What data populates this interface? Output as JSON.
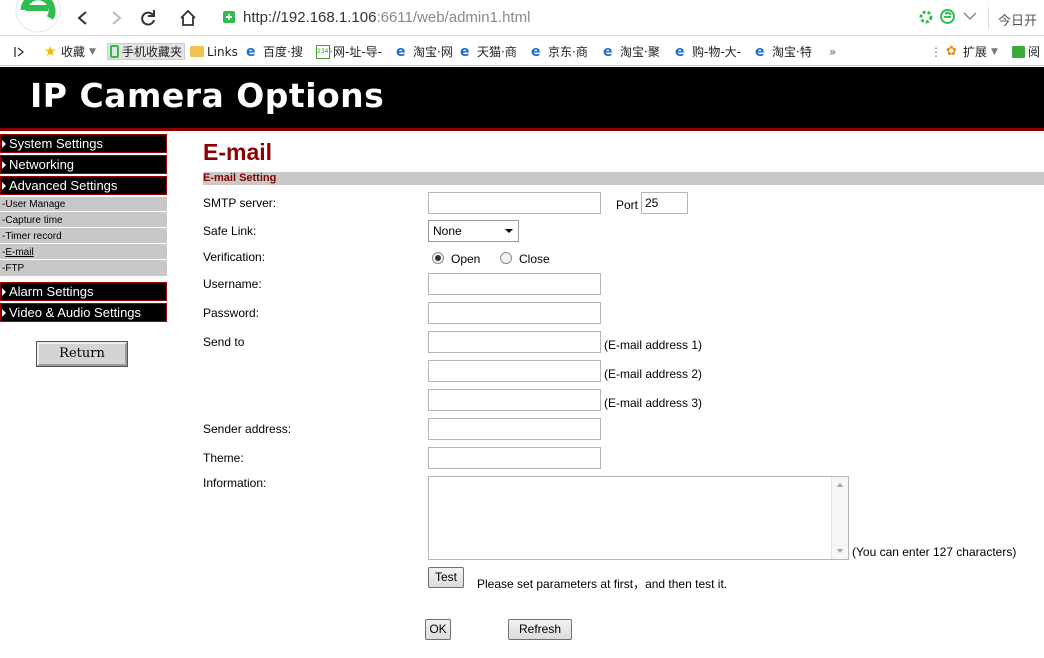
{
  "browser": {
    "url_host": "http://192.168.1.106",
    "url_rest": ":6611/web/admin1.html",
    "today_label": "今日开",
    "bookmarks": [
      {
        "label": "收藏",
        "icon": "star-icon"
      },
      {
        "label": "手机收藏夹",
        "icon": "phone-icon"
      },
      {
        "label": "Links",
        "icon": "folder-icon"
      },
      {
        "label": "百度·搜",
        "icon": "ie-icon"
      },
      {
        "label": "网-址-导-",
        "icon": "2345-icon"
      },
      {
        "label": "淘宝·网",
        "icon": "ie-icon"
      },
      {
        "label": "天猫·商",
        "icon": "ie-icon"
      },
      {
        "label": "京东·商",
        "icon": "ie-icon"
      },
      {
        "label": "淘宝·聚",
        "icon": "ie-icon"
      },
      {
        "label": "购-物-大-",
        "icon": "ie-icon"
      },
      {
        "label": "淘宝·特",
        "icon": "ie-icon"
      }
    ],
    "more_label": "»",
    "extend_label": "扩展",
    "read_label": "阅"
  },
  "banner": {
    "title": "IP Camera Options"
  },
  "menu": {
    "system": "System Settings",
    "networking": "Networking",
    "advanced": "Advanced Settings",
    "sub": [
      "User Manage",
      "Capture time",
      "Timer record",
      "E-mail",
      "FTP"
    ],
    "alarm": "Alarm Settings",
    "video": "Video & Audio Settings",
    "return": "Return"
  },
  "page": {
    "title": "E-mail",
    "section": "E-mail Setting"
  },
  "form": {
    "smtp_label": "SMTP server:",
    "smtp_value": "",
    "port_label": "Port",
    "port_value": "25",
    "safe_link_label": "Safe Link:",
    "safe_link_value": "None",
    "verification_label": "Verification:",
    "verification_open": "Open",
    "verification_close": "Close",
    "verification_selected": "Open",
    "username_label": "Username:",
    "password_label": "Password:",
    "send_to_label": "Send to",
    "email1_hint": "(E-mail address 1)",
    "email2_hint": "(E-mail address 2)",
    "email3_hint": "(E-mail address 3)",
    "sender_label": "Sender address:",
    "theme_label": "Theme:",
    "information_label": "Information:",
    "information_hint": "(You can enter 127 characters)",
    "test_button": "Test",
    "test_hint": "Please set parameters at first，and then test it.",
    "ok_button": "OK",
    "refresh_button": "Refresh"
  }
}
